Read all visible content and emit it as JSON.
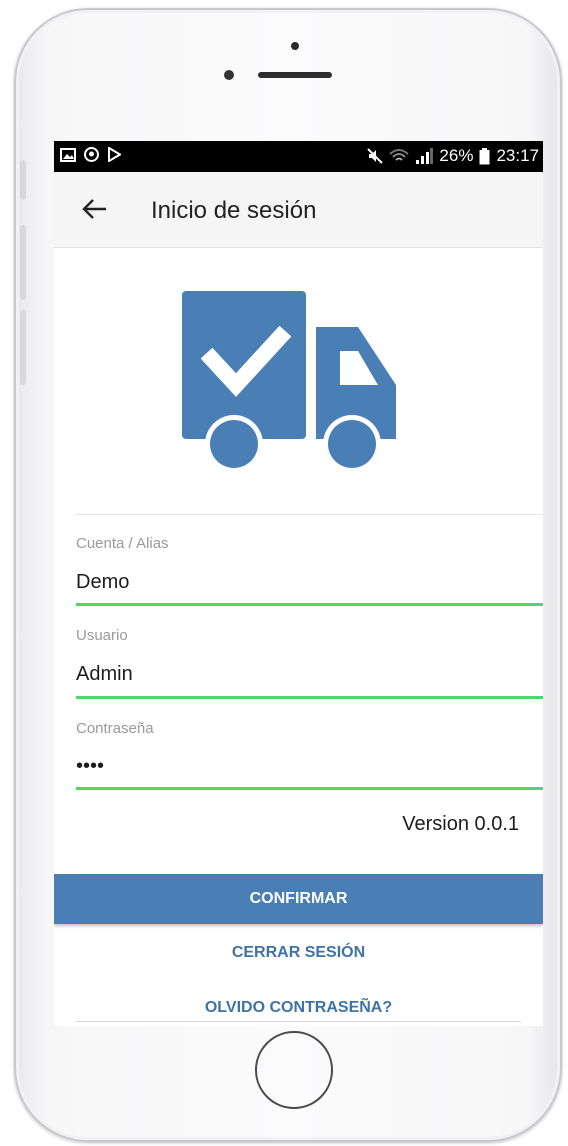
{
  "status_bar": {
    "left_icons": [
      "image-icon",
      "pinterest-icon",
      "play-store-icon"
    ],
    "right_icons": [
      "mute-icon",
      "wifi-icon",
      "signal-icon"
    ],
    "battery": "26%",
    "time": "23:17"
  },
  "app_bar": {
    "back_icon": "arrow-left-icon",
    "title": "Inicio de sesión"
  },
  "logo": {
    "icon": "truck-check-icon",
    "color": "#4a7fb5"
  },
  "form": {
    "account": {
      "label": "Cuenta / Alias",
      "value": "Demo"
    },
    "user": {
      "label": "Usuario",
      "value": "Admin"
    },
    "password": {
      "label": "Contraseña",
      "value": "••••"
    }
  },
  "version": "Version 0.0.1",
  "actions": {
    "confirm": "CONFIRMAR",
    "logout": "CERRAR SESIÓN",
    "forgot": "OLVIDO CONTRASEÑA?"
  },
  "colors": {
    "primary": "#4a7fb5",
    "field_underline": "#4cd964",
    "link": "#3e73a8"
  }
}
